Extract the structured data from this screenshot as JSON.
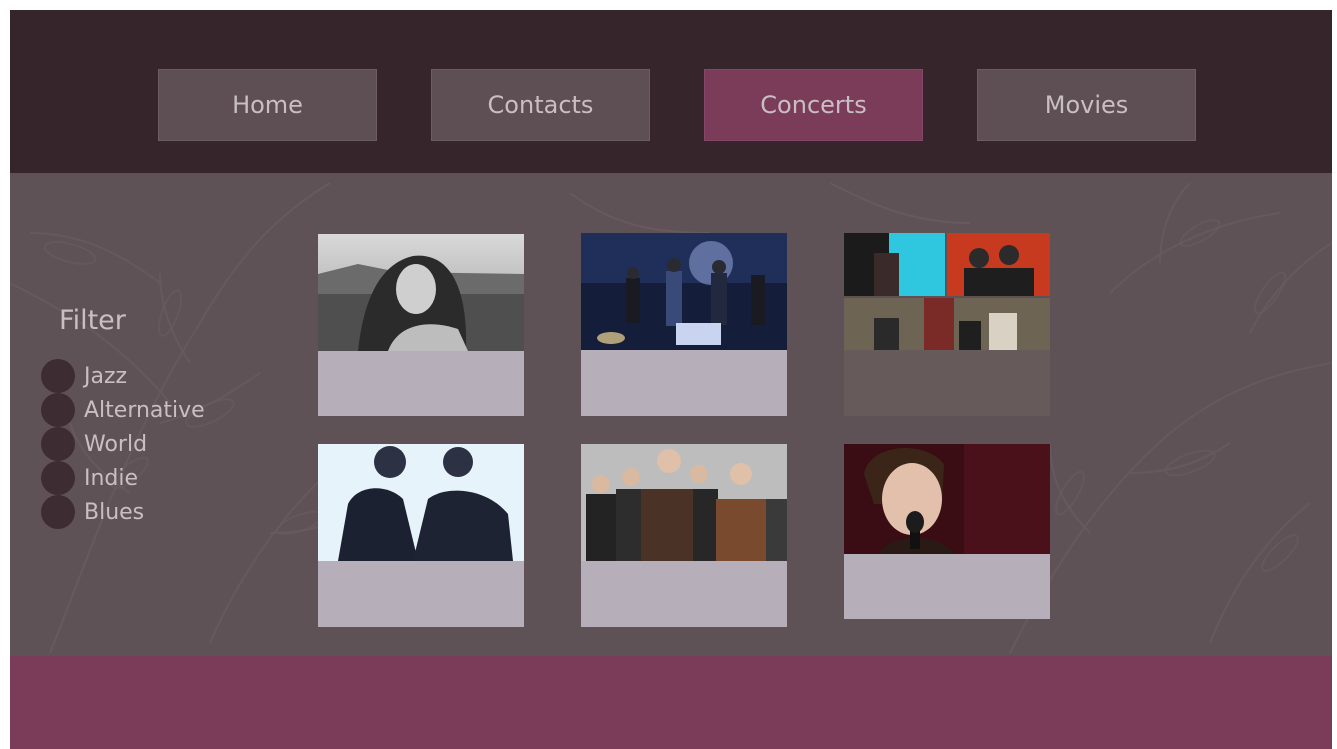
{
  "nav": {
    "items": [
      {
        "label": "Home",
        "active": false
      },
      {
        "label": "Contacts",
        "active": false
      },
      {
        "label": "Concerts",
        "active": true
      },
      {
        "label": "Movies",
        "active": false
      }
    ]
  },
  "filter": {
    "title": "Filter",
    "options": [
      "Jazz",
      "Alternative",
      "World",
      "Indie",
      "Blues"
    ]
  },
  "cards": [
    {
      "photo": "woman-portrait-bw-photo"
    },
    {
      "photo": "band-live-stage-photo"
    },
    {
      "photo": "band-collage-photo"
    },
    {
      "photo": "duo-portrait-photo"
    },
    {
      "photo": "group-band-photo"
    },
    {
      "photo": "singer-microphone-photo"
    }
  ],
  "colors": {
    "header": "#36262b",
    "content": "#5f5257",
    "nav_button": "#5d4f54",
    "nav_active": "#7b3c5a",
    "footer": "#7b3c5a",
    "radio": "#3d2c32",
    "caption": "#b6aeb9",
    "text": "#c9bec3"
  }
}
